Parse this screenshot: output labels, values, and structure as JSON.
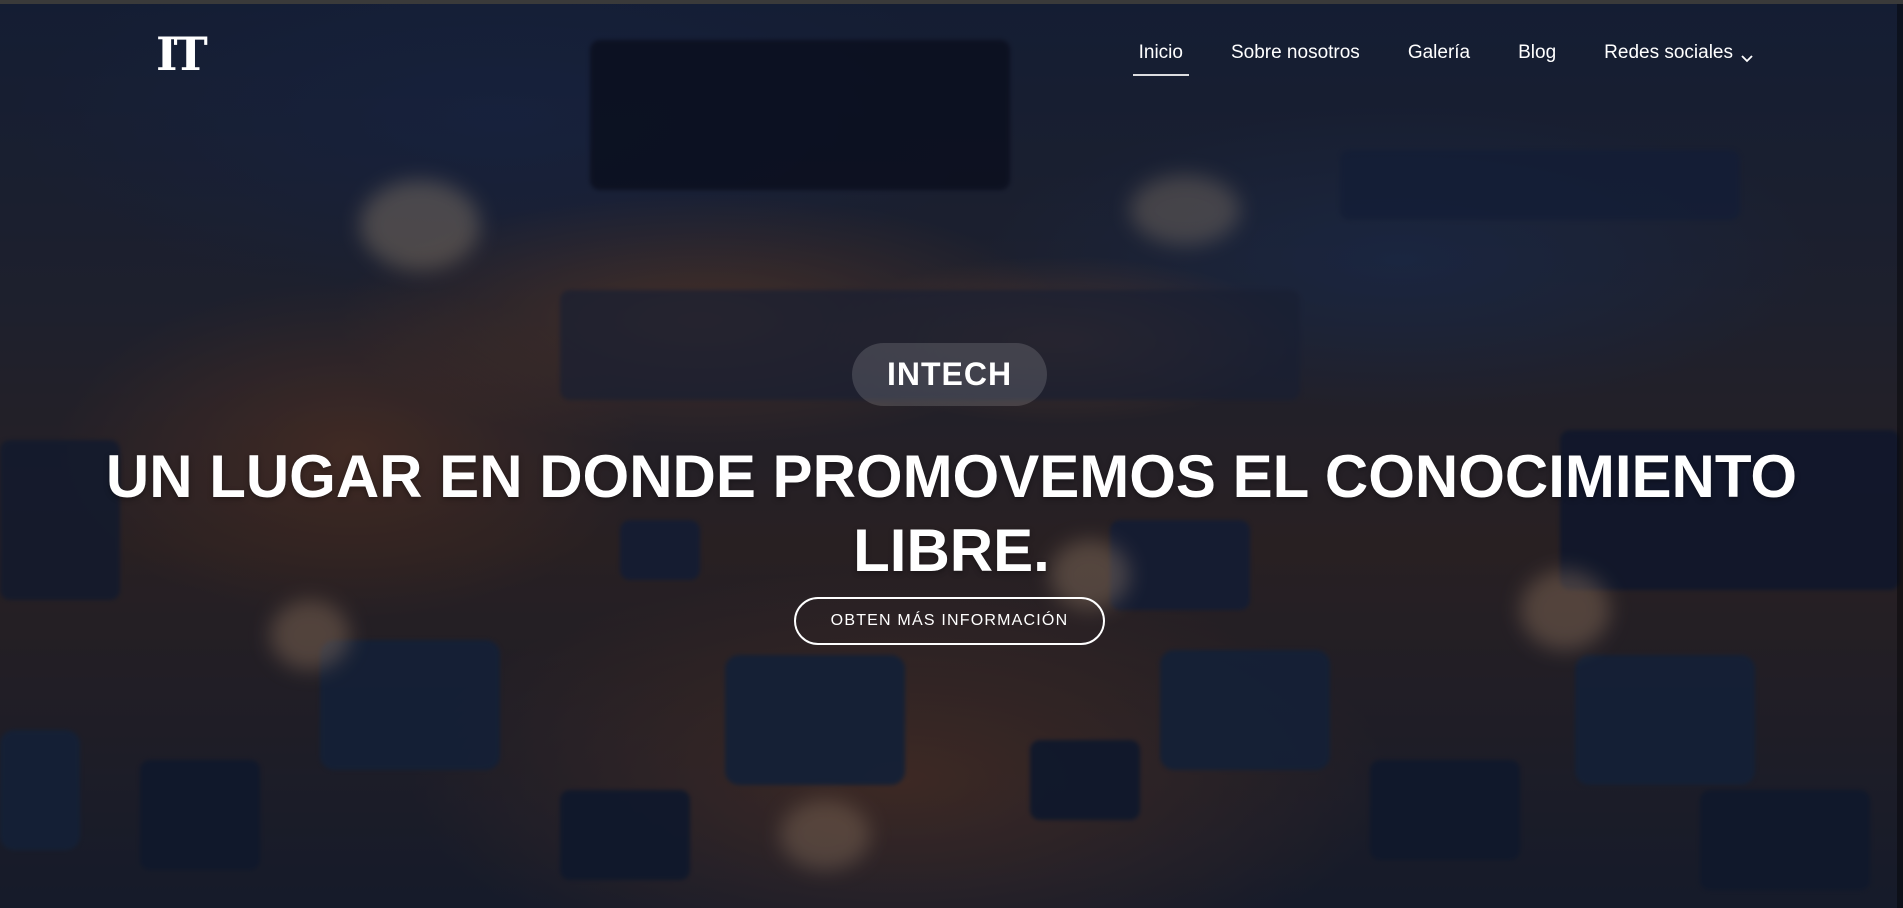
{
  "brand": {
    "logo_text": "IT"
  },
  "nav": {
    "items": [
      {
        "label": "Inicio",
        "active": true
      },
      {
        "label": "Sobre nosotros"
      },
      {
        "label": "Galería"
      },
      {
        "label": "Blog"
      },
      {
        "label": "Redes sociales",
        "dropdown": true
      }
    ]
  },
  "hero": {
    "badge": "INTECH",
    "headline_line1": "UN LUGAR EN DONDE PROMOVEMOS EL CONOCIMIENTO",
    "headline_line2": "LIBRE.",
    "cta_label": "OBTEN MÁS INFORMACIÓN"
  },
  "icons": {
    "dropdown": "chevron-down-icon"
  },
  "colors": {
    "text": "#ffffff",
    "overlay": "#0a0e1e",
    "accent_copper": "#a05f32"
  }
}
